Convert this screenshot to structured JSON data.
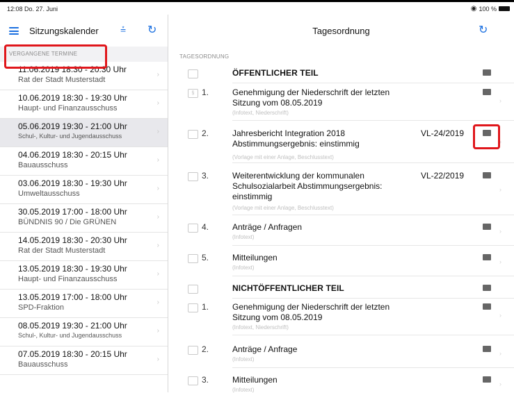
{
  "status": {
    "time_date": "12:08  Do. 27. Juni",
    "battery": "100 %"
  },
  "sidebar": {
    "title": "Sitzungskalender",
    "section": "VERGANGENE TERMINE",
    "meetings": [
      {
        "date": "11.06.2019 18:30 - 20:30 Uhr",
        "committee": "Rat der Stadt Musterstadt"
      },
      {
        "date": "10.06.2019 18:30 - 19:30 Uhr",
        "committee": "Haupt- und Finanzausschuss"
      },
      {
        "date": "05.06.2019 19:30 - 21:00 Uhr",
        "committee": "Schul-, Kultur- und Jugendausschuss"
      },
      {
        "date": "04.06.2019 18:30 - 20:15 Uhr",
        "committee": "Bauausschuss"
      },
      {
        "date": "03.06.2019 18:30 - 19:30 Uhr",
        "committee": "Umweltausschuss"
      },
      {
        "date": "30.05.2019 17:00 - 18:00 Uhr",
        "committee": "BÜNDNIS 90 / Die GRÜNEN"
      },
      {
        "date": "14.05.2019 18:30 - 20:30 Uhr",
        "committee": "Rat der Stadt Musterstadt"
      },
      {
        "date": "13.05.2019 18:30 - 19:30 Uhr",
        "committee": "Haupt- und Finanzausschuss"
      },
      {
        "date": "13.05.2019 17:00 - 18:00 Uhr",
        "committee": "SPD-Fraktion"
      },
      {
        "date": "08.05.2019 19:30 - 21:00 Uhr",
        "committee": "Schul-, Kultur- und Jugendausschuss"
      },
      {
        "date": "07.05.2019 18:30 - 20:15 Uhr",
        "committee": "Bauausschuss"
      }
    ]
  },
  "main": {
    "title": "Tagesordnung",
    "section": "TAGESORDNUNG",
    "public_heading": "ÖFFENTLICHER TEIL",
    "private_heading": "NICHTÖFFENTLICHER TEIL",
    "items": [
      {
        "num": "1.",
        "text": "Genehmigung der Niederschrift der letzten Sitzung vom 08.05.2019",
        "ref": "",
        "sub": "(Infotext, Niederschrift)"
      },
      {
        "num": "2.",
        "text": "Jahresbericht Integration 2018 Abstimmungsergebnis: einstimmig",
        "ref": "VL-24/2019",
        "sub": "(Vorlage mit einer Anlage, Beschlusstext)"
      },
      {
        "num": "3.",
        "text": "Weiterentwicklung der kommunalen Schulsozialarbeit Abstimmungsergebnis: einstimmig",
        "ref": "VL-22/2019",
        "sub": "(Vorlage mit einer Anlage, Beschlusstext)"
      },
      {
        "num": "4.",
        "text": "Anträge / Anfragen",
        "ref": "",
        "sub": "(Infotext)"
      },
      {
        "num": "5.",
        "text": "Mitteilungen",
        "ref": "",
        "sub": "(Infotext)"
      }
    ],
    "private_items": [
      {
        "num": "1.",
        "text": "Genehmigung der Niederschrift der letzten Sitzung vom 08.05.2019",
        "sub": "(Infotext, Niederschrift)"
      },
      {
        "num": "2.",
        "text": "Anträge / Anfrage",
        "sub": "(Infotext)"
      },
      {
        "num": "3.",
        "text": "Mitteilungen",
        "sub": "(Infotext)"
      }
    ]
  }
}
